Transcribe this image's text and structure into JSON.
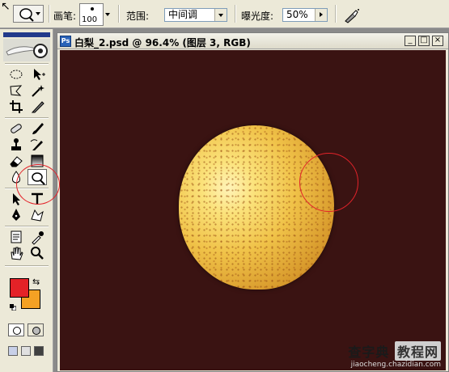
{
  "options_bar": {
    "brush_label": "画笔:",
    "brush_size": "100",
    "range_label": "范围:",
    "range_value": "中间调",
    "exposure_label": "曝光度:",
    "exposure_value": "50%"
  },
  "toolbox": {
    "foreground_color": "#e42227",
    "background_color": "#f4a124",
    "active_tool": "dodge-tool",
    "tools": [
      "marquee",
      "move",
      "lasso",
      "magic-wand",
      "crop",
      "slice",
      "healing-brush",
      "brush",
      "clone-stamp",
      "history-brush",
      "eraser",
      "gradient",
      "blur",
      "dodge",
      "path-selection",
      "type",
      "pen",
      "custom-shape",
      "notes",
      "eyedropper",
      "hand",
      "zoom"
    ]
  },
  "document": {
    "title": "白梨_2.psd @ 96.4% (图层 3, RGB)",
    "minimize": "_",
    "maximize": "□",
    "close": "×",
    "canvas_color": "#3a1312",
    "subject_color": "#f0c248"
  },
  "watermark": {
    "site_name_a": "查字典",
    "site_name_b": "教程网",
    "site_url": "jiaocheng.chazidian.com"
  },
  "annotation_color": "#e3232a"
}
